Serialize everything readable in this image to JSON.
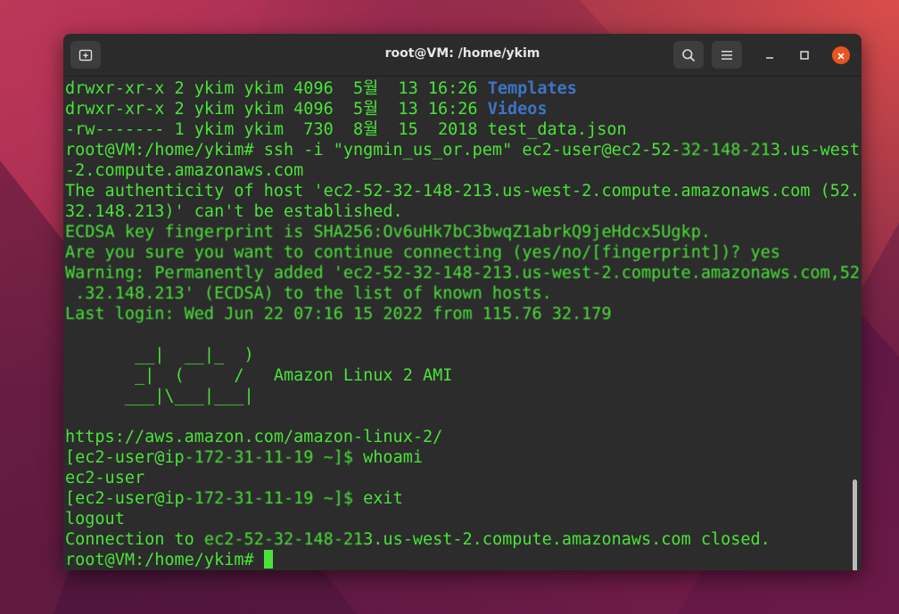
{
  "window": {
    "title": "root@VM: /home/ykim",
    "new_tab_icon": "new-tab-icon",
    "search_icon": "search-icon",
    "menu_icon": "hamburger-menu-icon",
    "minimize_icon": "minimize-icon",
    "maximize_icon": "maximize-icon",
    "close_icon": "close-icon",
    "close_color": "#e95420"
  },
  "colors": {
    "text": "#4ae338",
    "directory": "#3d74c6",
    "background": "#2c2c2c"
  },
  "terminal": {
    "lines": [
      {
        "prefix": "drwxr-xr-x 2 ykim ykim 4096  5월  13 16:26 ",
        "dir": "Templates"
      },
      {
        "prefix": "drwxr-xr-x 2 ykim ykim 4096  5월  13 16:26 ",
        "dir": "Videos"
      },
      {
        "text": "-rw------- 1 ykim ykim  730  8월  15  2018 test_data.json"
      },
      {
        "text": "root@VM:/home/ykim# ssh -i \"yngmin_us_or.pem\" ec2-user@ec2-52-",
        "obscured": "32-148-21",
        "suffix": "3.us-west"
      },
      {
        "text": "-2.compute.amazonaws.com"
      },
      {
        "text": "The authenticity of host 'ec2-52-32-148-213.us-west-2.compute.amazonaws.com (52."
      },
      {
        "text": "32.148.213)' can't be established."
      },
      {
        "obscured": "ECDSA key fingerprint is SHA256:Ov6uHk7bC3bwqZ1abrkQ9jeHdcx5Ugkp."
      },
      {
        "obscured": "Are you sure you want to continue connecting (yes/no/[fingerprint])? yes"
      },
      {
        "obscured": "Warning: Permanently added 'ec2-52-32-148-213.us-west-2.compute.amazonaws.com,52"
      },
      {
        "obscured": " .32.148.213' (ECDSA) to the list of known hosts."
      },
      {
        "obscured": "Last login: Wed Jun 22 07:16 15 2022 from 115.76 32.179"
      },
      {
        "text": ""
      },
      {
        "text": "       __|  __|_  )"
      },
      {
        "text": "       _|  (     /   Amazon Linux 2 AMI"
      },
      {
        "text": "      ___|\\___|___|"
      },
      {
        "text": ""
      },
      {
        "text": "https://aws.amazon.com/amazon-linux-2/"
      },
      {
        "text": "[ec2-user@ip",
        "obscured": "-172-31-11-19 ~]$",
        "suffix": " whoami"
      },
      {
        "text": "ec2-user"
      },
      {
        "text": "[ec2-user@ip",
        "obscured": "-172-31-11-19 ~]$",
        "suffix": " exit"
      },
      {
        "text": "logout"
      },
      {
        "text": "Connection to",
        "obscured": " ec2-52-32-148-21",
        "suffix": "3.us-west-2.compute.amazonaws.com closed."
      },
      {
        "text": "root@VM:/home/ykim# ",
        "cursor": true
      }
    ]
  }
}
